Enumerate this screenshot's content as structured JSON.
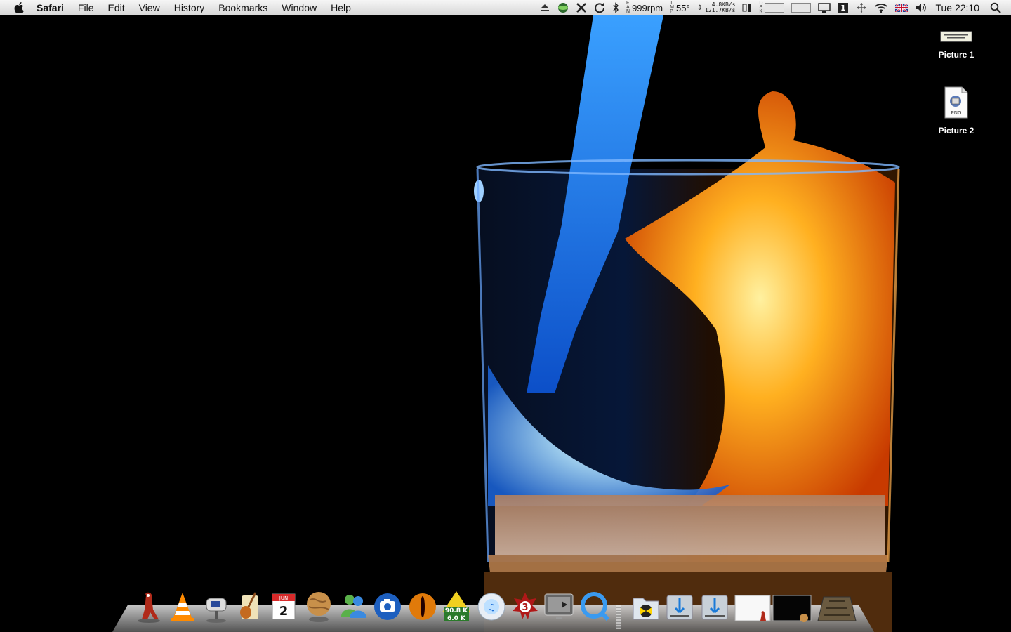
{
  "menubar": {
    "app_name": "Safari",
    "menus": [
      "File",
      "Edit",
      "View",
      "History",
      "Bookmarks",
      "Window",
      "Help"
    ],
    "fan_speed": "999rpm",
    "temperature": "55°",
    "net_up": "4.8KB/s",
    "net_down": "121.7KB/s",
    "clock": "Tue 22:10"
  },
  "desktop": {
    "icons": [
      {
        "label": "Picture 1"
      },
      {
        "label": "Picture 2"
      }
    ]
  },
  "dock": {
    "calendar_month": "JUN",
    "calendar_day": "2",
    "meter_top": "90.8 K",
    "meter_bottom": "6.0 K",
    "badge_number": "3",
    "png_label": "PNG"
  },
  "colors": {
    "menubar_top": "#f6f6f6",
    "menubar_bottom": "#d8d8d8",
    "desktop": "#000000",
    "water_blue": "#2a8cff",
    "fire_orange": "#ff8a10"
  }
}
